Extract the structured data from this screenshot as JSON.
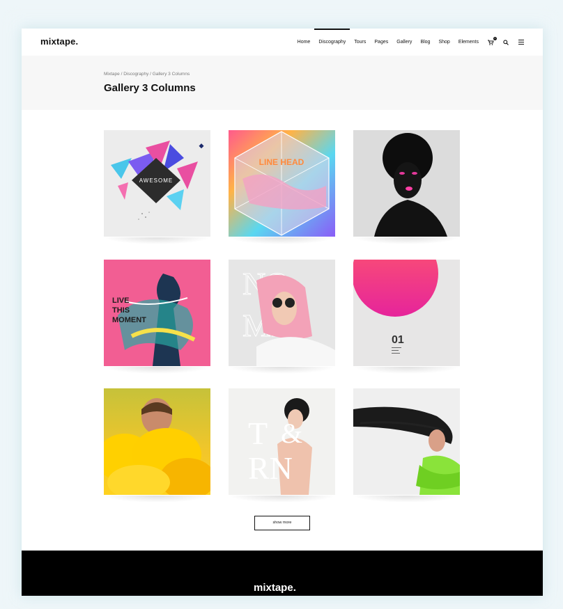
{
  "header": {
    "logo": "mixtape.",
    "nav": [
      {
        "label": "Home"
      },
      {
        "label": "Discography",
        "active": true
      },
      {
        "label": "Tours"
      },
      {
        "label": "Pages"
      },
      {
        "label": "Gallery"
      },
      {
        "label": "Blog"
      },
      {
        "label": "Shop"
      },
      {
        "label": "Elements"
      }
    ],
    "icons": [
      "cart-icon",
      "search-icon",
      "menu-icon"
    ],
    "cart_count": "0"
  },
  "page": {
    "breadcrumb": [
      "Mixtape",
      "Discography",
      "Gallery 3 Columns"
    ],
    "breadcrumb_sep": " / ",
    "title": "Gallery 3 Columns"
  },
  "gallery": {
    "tiles": [
      {
        "name": "awesome",
        "text": "AWESOME"
      },
      {
        "name": "line-head",
        "text": "LINE HEAD"
      },
      {
        "name": "pink-lips-portrait",
        "text": ""
      },
      {
        "name": "live-this-moment",
        "text": "LIVE THIS MOMENT"
      },
      {
        "name": "pink-hair",
        "text": ""
      },
      {
        "name": "pink-sun",
        "text": "01"
      },
      {
        "name": "yellow-smoke",
        "text": ""
      },
      {
        "name": "t-and-rn",
        "text": "T & RN"
      },
      {
        "name": "hair-flip",
        "text": ""
      }
    ],
    "show_more": "show more"
  },
  "footer": {
    "logo": "mixtape."
  }
}
